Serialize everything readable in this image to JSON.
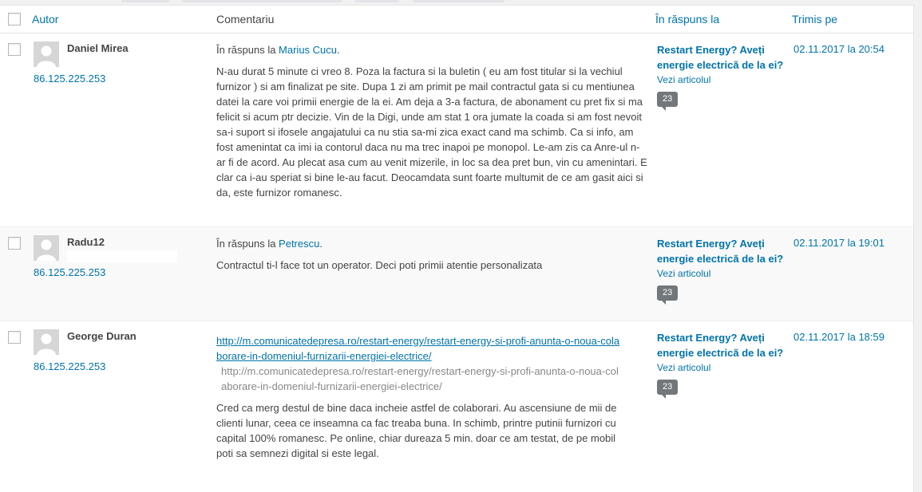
{
  "colors": {
    "link": "#0073aa",
    "text": "#444444",
    "bubble": "#72777c",
    "alt_row": "#f9f9f9"
  },
  "header": {
    "author": "Autor",
    "comment": "Comentariu",
    "in_response": "În răspuns la",
    "submitted": "Trimis pe"
  },
  "rows": [
    {
      "author": "Daniel Mirea",
      "ip": "86.125.225.253",
      "in_reply_prefix": "În răspuns la ",
      "in_reply_name": "Marius Cucu",
      "text": "N-au durat 5 minute ci vreo 8. Poza la factura si la buletin ( eu am fost titular si la vechiul furnizor ) si am finalizat pe site. Dupa 1 zi am primit pe mail contractul gata si cu mentiunea datei la care voi primii energie de la ei. Am deja a 3-a factura, de abonament cu pret fix si ma felicit si acum ptr decizie. Vin de la Digi, unde am stat 1 ora jumate la coada si am fost nevoit sa-i suport si ifosele angajatului ca nu stia sa-mi zica exact cand ma schimb. Ca si info, am fost amenintat ca imi ia contorul daca nu ma trec inapoi pe monopol. Le-am zis ca Anre-ul n-ar fi de acord. Au plecat asa cum au venit mizerile, in loc sa dea pret bun, vin cu amenintari. E clar ca i-au speriat si bine le-au facut. Deocamdata sunt foarte multumit de ce am gasit aici si da, este furnizor romanesc.",
      "response_title": "Restart Energy? Aveți energie electrică de la ei?",
      "view_post": "Vezi articolul",
      "comment_count": "23",
      "date": "02.11.2017 la 20:54"
    },
    {
      "author": "Radu12",
      "ip": "86.125.225.253",
      "in_reply_prefix": "În răspuns la ",
      "in_reply_name": "Petrescu",
      "text": "Contractul ti-l face tot un operator. Deci poti primii atentie personalizata",
      "response_title": "Restart Energy? Aveți energie electrică de la ei?",
      "view_post": "Vezi articolul",
      "comment_count": "23",
      "date": "02.11.2017 la 19:01"
    },
    {
      "author": "George Duran",
      "ip": "86.125.225.253",
      "link_text": "http://m.comunicatedepresa.ro/restart-energy/restart-energy-si-profi-anunta-o-noua-colaborare-in-domeniul-furnizarii-energiei-electrice/",
      "link_plain": "http://m.comunicatedepresa.ro/restart-energy/restart-energy-si-profi-anunta-o-noua-colaborare-in-domeniul-furnizarii-energiei-electrice/",
      "text": "Cred ca merg destul de bine daca incheie astfel de colaborari. Au ascensiune de mii de clienti lunar, ceea ce inseamna ca fac treaba buna. In schimb, printre putinii furnizori cu capital 100% romanesc. Pe online, chiar dureaza 5 min. doar ce am testat, de pe mobil poti sa semnezi digital si este legal.",
      "response_title": "Restart Energy? Aveți energie electrică de la ei?",
      "view_post": "Vezi articolul",
      "comment_count": "23",
      "date": "02.11.2017 la 18:59"
    }
  ]
}
